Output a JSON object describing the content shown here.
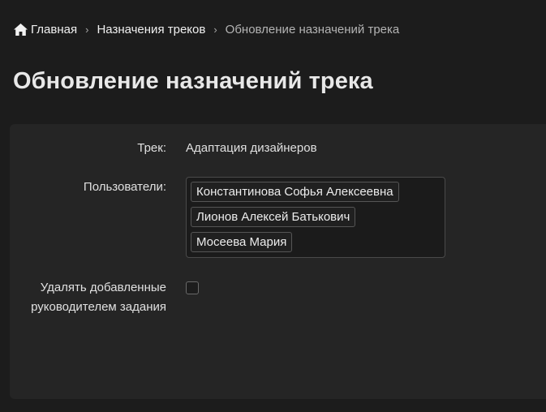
{
  "breadcrumb": {
    "home_icon": "home-icon",
    "home_label": "Главная",
    "separator": "›",
    "level2_label": "Назначения треков",
    "current_label": "Обновление назначений трека"
  },
  "page": {
    "title": "Обновление назначений трека"
  },
  "form": {
    "track_label": "Трек:",
    "track_value": "Адаптация дизайнеров",
    "users_label": "Пользователи:",
    "users": [
      "Константинова Софья Алексеевна",
      "Лионов Алексей Батькович",
      "Мосеева Мария"
    ],
    "delete_label": "Удалять добавленные руководителем задания",
    "delete_checked": false
  },
  "colors": {
    "background": "#1c1c1c",
    "card": "#252525",
    "text": "#e6e6e6"
  }
}
